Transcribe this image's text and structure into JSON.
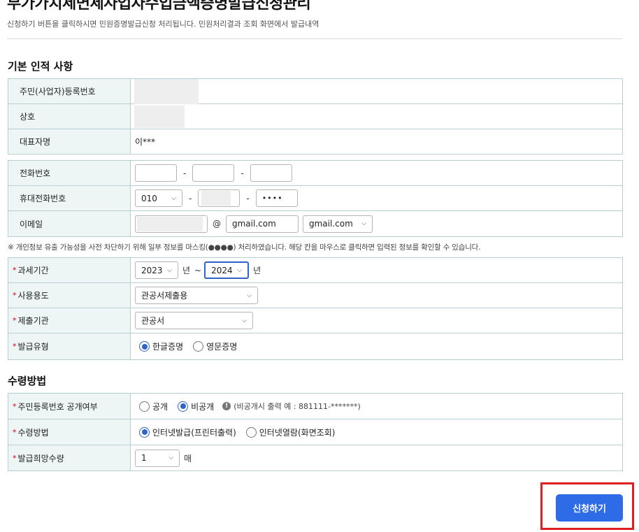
{
  "page": {
    "title": "부가가치세면세사업자수입금액증명발급신청관리",
    "description": "신청하기 버튼을 클릭하시면 민원증명발급신청 처리됩니다. 민원처리결과 조회 화면에서 발급내역"
  },
  "basic_info": {
    "section_title": "기본 인적 사항",
    "resident_number_label": "주민(사업자)등록번호",
    "company_label": "상호",
    "representative_label": "대표자명",
    "representative_value": "이***"
  },
  "contact": {
    "phone_label": "전화번호",
    "phone_dash": "-",
    "mobile_label": "휴대전화번호",
    "mobile_prefix": "010",
    "mobile_last": "••••",
    "email_label": "이메일",
    "email_at": "@",
    "email_domain": "gmail.com",
    "email_domain_select": "gmail.com"
  },
  "notice": "※ 개인정보 유출 가능성을 사전 차단하기 위해 일부 정보를 마스킹(●●●●) 처리하였습니다. 해당 칸을 마우스로 클릭하면 입력된 정보를 확인할 수 있습니다.",
  "application": {
    "tax_period_label": "과세기간",
    "start_year": "2023",
    "end_year": "2024",
    "year_unit": "년",
    "range_sep": "~",
    "usage_label": "사용용도",
    "usage_value": "관공서제출용",
    "agency_label": "제출기관",
    "agency_value": "관공서",
    "issue_type_label": "발급유형",
    "issue_type_options": [
      "한글증명",
      "영문증명"
    ],
    "issue_type_selected": "한글증명"
  },
  "receipt": {
    "section_title": "수령방법",
    "disclose_label": "주민등록번호 공개여부",
    "disclose_options": [
      "공개",
      "비공개"
    ],
    "disclose_selected": "비공개",
    "disclose_note": "(비공개시 출력 예 : 881111-*******)",
    "method_label": "수령방법",
    "method_options": [
      "인터넷발급(프린터출력)",
      "인터넷열람(화면조회)"
    ],
    "method_selected": "인터넷발급(프린터출력)",
    "quantity_label": "발급희망수량",
    "quantity_value": "1",
    "quantity_unit": "매"
  },
  "required_mark": "*",
  "submit_label": "신청하기",
  "icons": {
    "select_arrow": "chevron-down-icon",
    "info": "info-icon"
  },
  "colors": {
    "primary": "#2e6be6",
    "highlight": "#e02020",
    "label_bg": "#eef5f5",
    "border": "#b7cfd0",
    "required": "#d0021b"
  }
}
